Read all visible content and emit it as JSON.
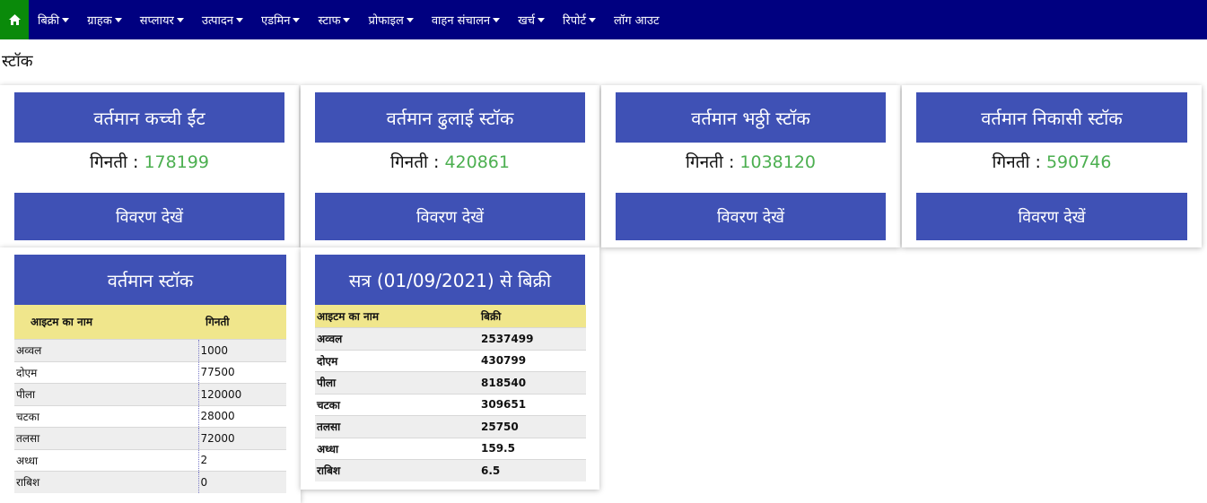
{
  "nav": {
    "home_icon": "home-icon",
    "items": [
      {
        "label": "बिक्री",
        "dropdown": true
      },
      {
        "label": "ग्राहक",
        "dropdown": true
      },
      {
        "label": "सप्लायर",
        "dropdown": true
      },
      {
        "label": "उत्पादन",
        "dropdown": true
      },
      {
        "label": "एडमिन",
        "dropdown": true
      },
      {
        "label": "स्टाफ",
        "dropdown": true
      },
      {
        "label": "प्रोफाइल",
        "dropdown": true
      },
      {
        "label": "वाहन संचालन",
        "dropdown": true
      },
      {
        "label": "खर्च",
        "dropdown": true
      },
      {
        "label": "रिपोर्ट",
        "dropdown": true
      },
      {
        "label": "लॉग आउट",
        "dropdown": false
      }
    ]
  },
  "page_title": "स्टॉक",
  "colors": {
    "navbar": "#000080",
    "home": "#0a8a0a",
    "card_header": "#3f51b5",
    "count_value": "#4caf50",
    "table_header": "#f0e68c"
  },
  "count_label": "गिनती :",
  "detail_label": "विवरण देखें",
  "cards": [
    {
      "title": "वर्तमान कच्ची ईंट",
      "count": "178199"
    },
    {
      "title": "वर्तमान ढुलाई स्टॉक",
      "count": "420861"
    },
    {
      "title": "वर्तमान भठ्ठी स्टॉक",
      "count": "1038120"
    },
    {
      "title": "वर्तमान निकासी स्टॉक",
      "count": "590746"
    }
  ],
  "stock_table": {
    "title": "वर्तमान स्टॉक",
    "headers": [
      "आइटम का नाम",
      "गिनती"
    ],
    "rows": [
      [
        "अव्वल",
        "1000"
      ],
      [
        "दोएम",
        "77500"
      ],
      [
        "पीला",
        "120000"
      ],
      [
        "चटका",
        "28000"
      ],
      [
        "तलसा",
        "72000"
      ],
      [
        "अध्धा",
        "2"
      ],
      [
        "राबिश",
        "0"
      ]
    ]
  },
  "sales_table": {
    "title": "सत्र (01/09/2021) से बिक्री",
    "headers": [
      "आइटम का नाम",
      "बिक्री"
    ],
    "rows": [
      [
        "अव्वल",
        "2537499"
      ],
      [
        "दोएम",
        "430799"
      ],
      [
        "पीला",
        "818540"
      ],
      [
        "चटका",
        "309651"
      ],
      [
        "तलसा",
        "25750"
      ],
      [
        "अध्धा",
        "159.5"
      ],
      [
        "राबिश",
        "6.5"
      ]
    ]
  }
}
